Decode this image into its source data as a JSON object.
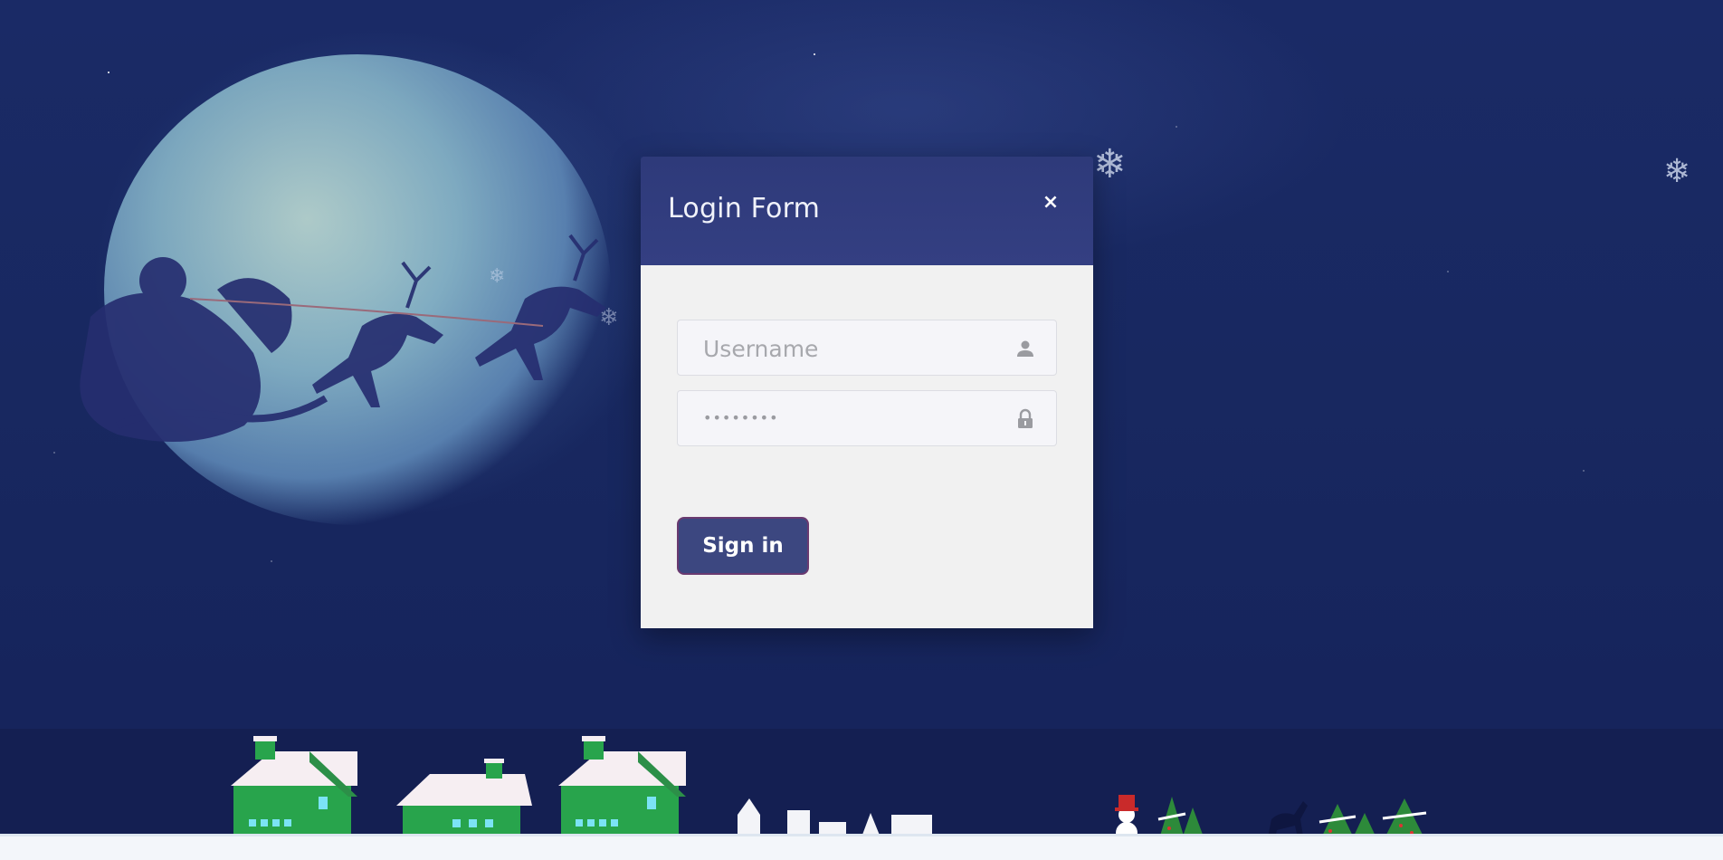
{
  "modal": {
    "title": "Login Form",
    "close_glyph": "×"
  },
  "form": {
    "username_placeholder": "Username",
    "username_icon": "user-icon",
    "password_value_masked": "••••••••",
    "password_icon": "lock-icon",
    "submit_label": "Sign in"
  },
  "background": {
    "scene": "night-christmas",
    "snowflake_glyph": "❄"
  },
  "colors": {
    "header": "#2f3a78",
    "body": "#f1f1f1",
    "button": "#3c4780",
    "sky": "#16235a"
  }
}
